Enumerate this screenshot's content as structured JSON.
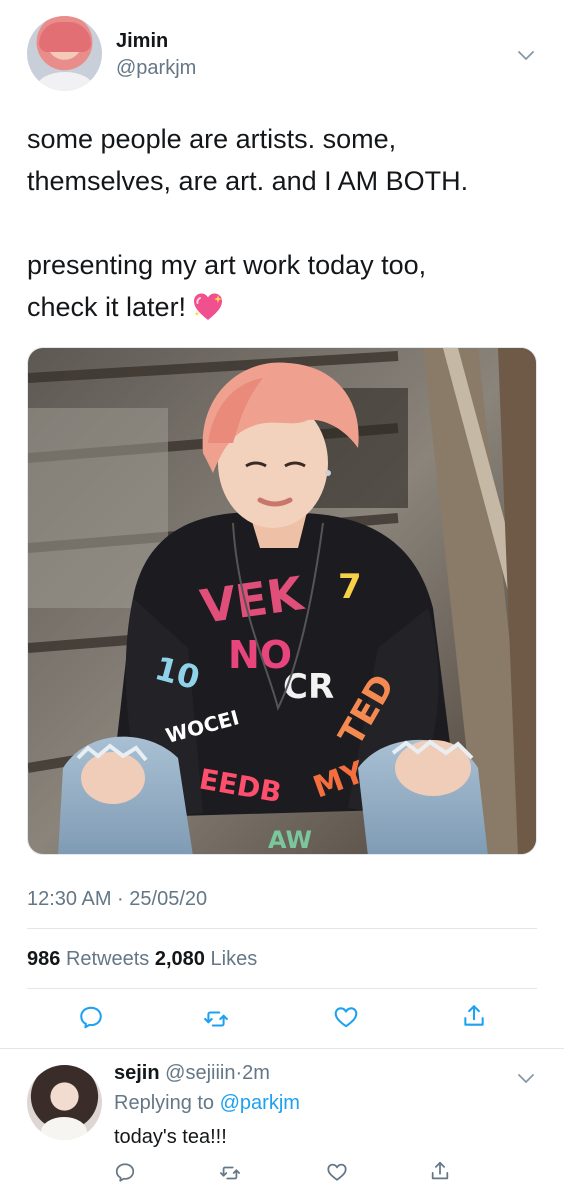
{
  "tweet": {
    "author_name": "Jimin",
    "author_handle": "@parkjm",
    "text_lines": [
      "some people are artists. some,",
      "themselves, are art. and I AM BOTH.",
      "presenting my art work today too,",
      "check it later!"
    ],
    "emoji": "sparkling-heart",
    "timestamp": "12:30 AM · 25/05/20",
    "retweets_count": "986",
    "retweets_label": "Retweets",
    "likes_count": "2,080",
    "likes_label": "Likes",
    "actions": [
      "reply-icon",
      "retweet-icon",
      "like-icon",
      "share-icon"
    ]
  },
  "reply": {
    "author_name": "sejin",
    "author_handle": "@sejiiin",
    "separator": "·",
    "time": "2m",
    "replying_prefix": "Replying to",
    "replying_to": "@parkjm",
    "text": "today's tea!!!"
  },
  "colors": {
    "text_primary": "#14171a",
    "text_secondary": "#657786",
    "link": "#1da1f2",
    "divider": "#e1e8ed",
    "icon": "#1da1f2"
  }
}
